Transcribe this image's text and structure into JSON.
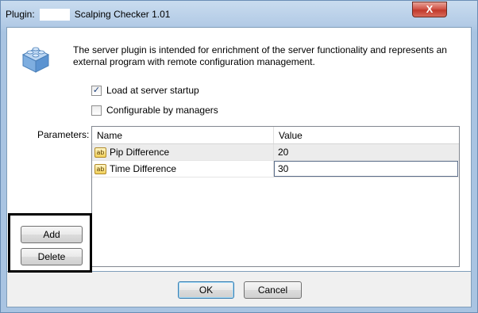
{
  "window": {
    "title_prefix": "Plugin:",
    "title_name": "Scalping Checker 1.01",
    "close_label": "X"
  },
  "plugin": {
    "icon": "lego-block-icon",
    "description": "The server plugin is intended for enrichment of the server functionality and represents an external program with remote configuration management."
  },
  "options": {
    "load_at_startup": {
      "label": "Load at server startup",
      "checked": true
    },
    "configurable_by_managers": {
      "label": "Configurable by managers",
      "checked": false
    }
  },
  "parameters": {
    "label": "Parameters:",
    "columns": {
      "name": "Name",
      "value": "Value"
    },
    "rows": [
      {
        "name": "Pip Difference",
        "value": "20"
      },
      {
        "name": "Time Difference",
        "value": "30"
      }
    ]
  },
  "actions": {
    "add": "Add",
    "delete": "Delete"
  },
  "footer": {
    "ok": "OK",
    "cancel": "Cancel"
  },
  "colors": {
    "highlight_frame": "#000000",
    "title_gradient": "#b3cbe6"
  }
}
